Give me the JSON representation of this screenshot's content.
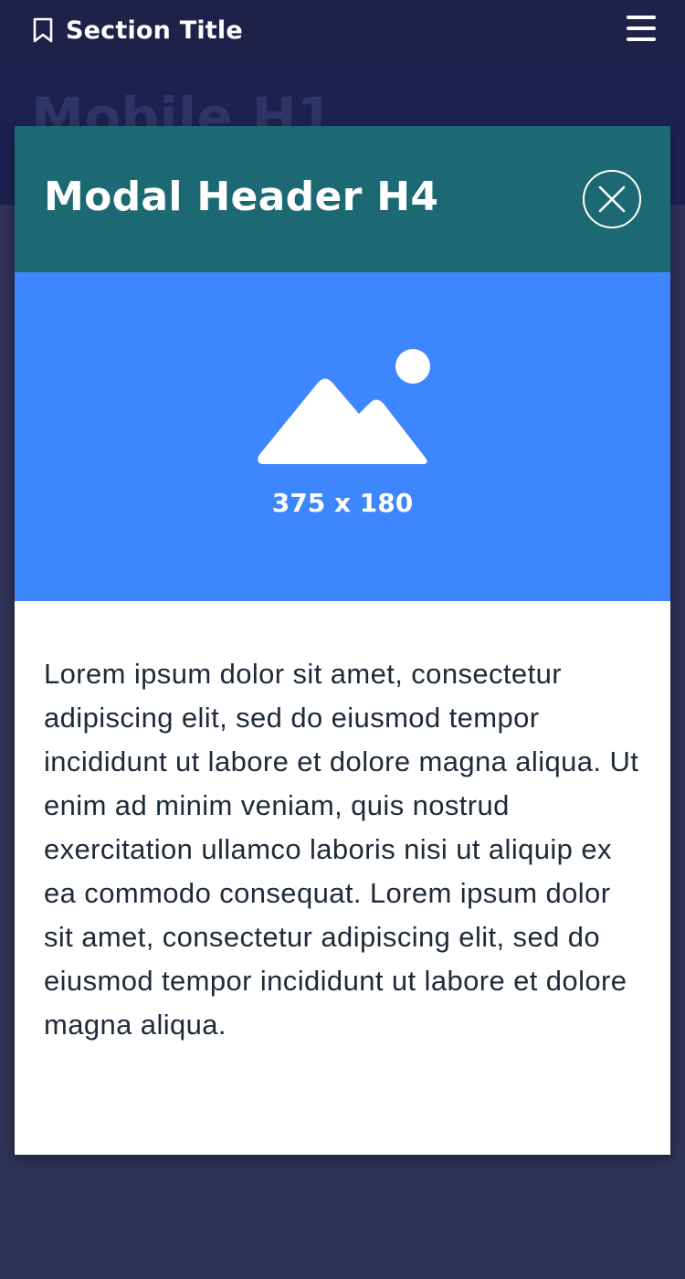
{
  "topbar": {
    "icon": "bookmark-icon",
    "section_title": "Section Title",
    "menu_icon": "hamburger-menu-icon"
  },
  "hero": {
    "title": "Mobile H1"
  },
  "modal": {
    "title": "Modal Header H4",
    "close_icon": "close-icon",
    "image_icon": "image-placeholder-icon",
    "image_caption": "375 x 180",
    "body": "Lorem ipsum dolor sit amet, consectetur adipiscing elit, sed do eiusmod tempor incididunt ut labore et dolore magna aliqua. Ut enim ad minim veniam, quis nostrud exercitation ullamco laboris nisi ut aliquip ex ea commodo consequat. Lorem ipsum dolor sit amet, consectetur adipiscing elit, sed do eiusmod tempor incididunt ut labore et dolore magna aliqua."
  },
  "colors": {
    "page_overlay": "#2f3155",
    "topbar": "#1f2148",
    "modal_header": "#1c6973",
    "image_placeholder": "#3e86fd",
    "body_text": "#1e2a3a"
  }
}
